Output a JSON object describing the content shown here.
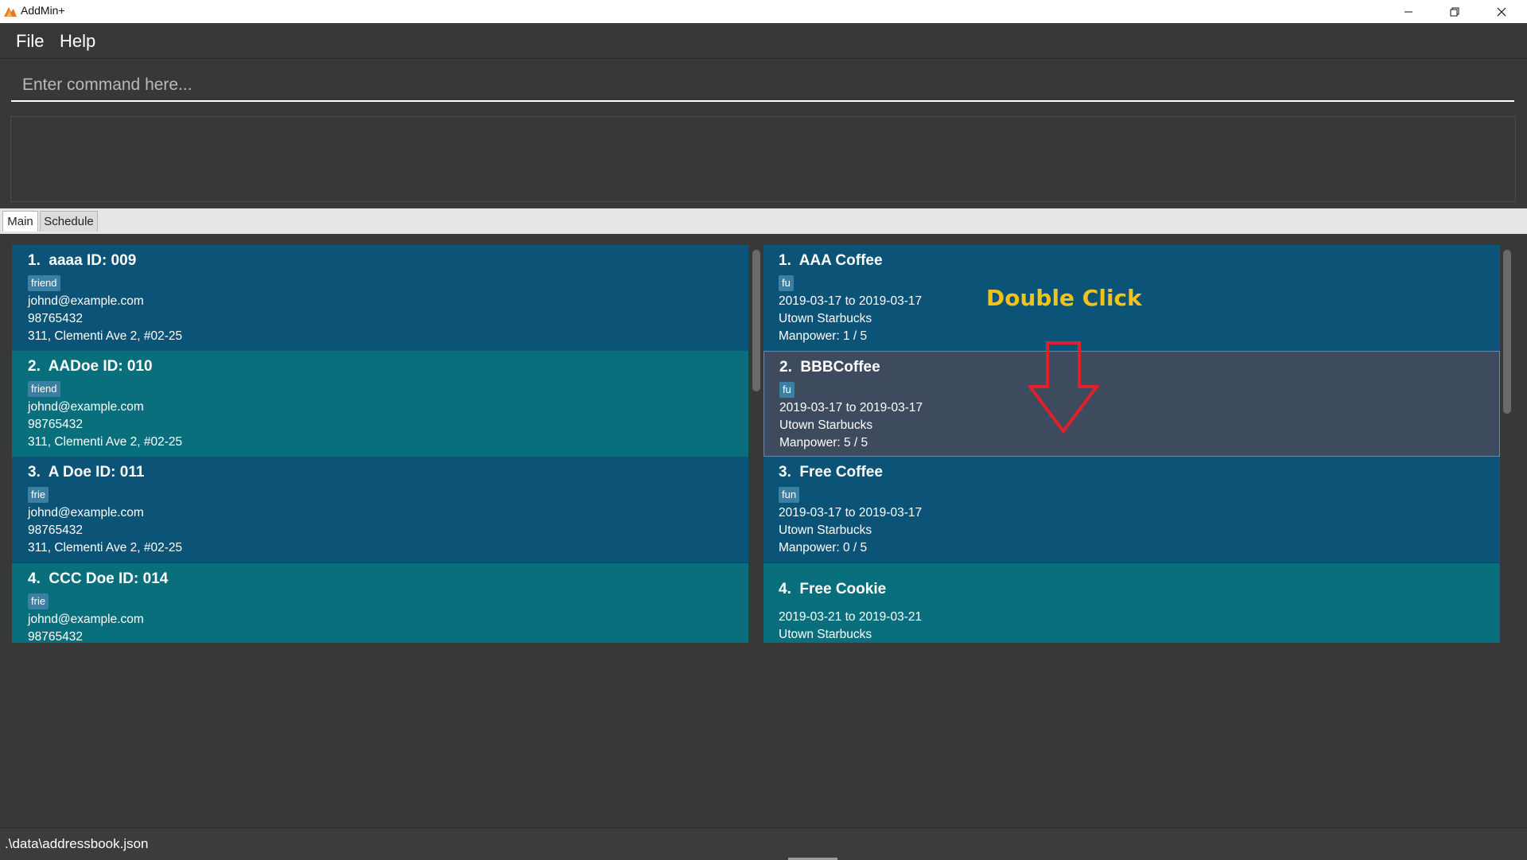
{
  "window": {
    "title": "AddMin+",
    "controls": [
      "minimize",
      "restore",
      "close"
    ]
  },
  "menu": {
    "items": [
      "File",
      "Help"
    ]
  },
  "command": {
    "placeholder": "Enter command here...",
    "value": ""
  },
  "result": {
    "text": ""
  },
  "tabs": [
    {
      "label": "Main",
      "active": true
    },
    {
      "label": "Schedule",
      "active": false
    }
  ],
  "persons": [
    {
      "title": "1.  aaaa ID: 009",
      "tag": "friend",
      "email": "johnd@example.com",
      "phone": "98765432",
      "address": "311, Clementi Ave 2, #02-25"
    },
    {
      "title": "2.  AADoe ID: 010",
      "tag": "friend",
      "email": "johnd@example.com",
      "phone": "98765432",
      "address": "311, Clementi Ave 2, #02-25"
    },
    {
      "title": "3.  A Doe ID: 011",
      "tag": "frie",
      "email": "johnd@example.com",
      "phone": "98765432",
      "address": "311, Clementi Ave 2, #02-25"
    },
    {
      "title": "4.  CCC Doe ID: 014",
      "tag": "frie",
      "email": "johnd@example.com",
      "phone": "98765432",
      "address": ""
    }
  ],
  "activities": [
    {
      "title": "1.  AAA Coffee",
      "tag": "fu",
      "dates": "2019-03-17 to 2019-03-17",
      "location": "Utown Starbucks",
      "manpower": "Manpower: 1 / 5"
    },
    {
      "title": "2.  BBBCoffee",
      "tag": "fu",
      "dates": "2019-03-17 to 2019-03-17",
      "location": "Utown Starbucks",
      "manpower": "Manpower: 5 / 5"
    },
    {
      "title": "3.  Free Coffee",
      "tag": "fun",
      "dates": "2019-03-17 to 2019-03-17",
      "location": "Utown Starbucks",
      "manpower": "Manpower: 0 / 5"
    },
    {
      "title": "4.  Free Cookie",
      "tag": "",
      "dates": "2019-03-21 to 2019-03-21",
      "location": "Utown Starbucks",
      "manpower": ""
    }
  ],
  "annotation": {
    "text": "Double Click",
    "color": "#f0c21a",
    "arrow_color": "#e0202a"
  },
  "status": {
    "path": ".\\data\\addressbook.json"
  },
  "colors": {
    "background": "#383838",
    "card_dark": "#0b5478",
    "card_teal": "#0a6f7d",
    "card_selected": "#3e4a5e",
    "tag": "#3b7fa3"
  }
}
